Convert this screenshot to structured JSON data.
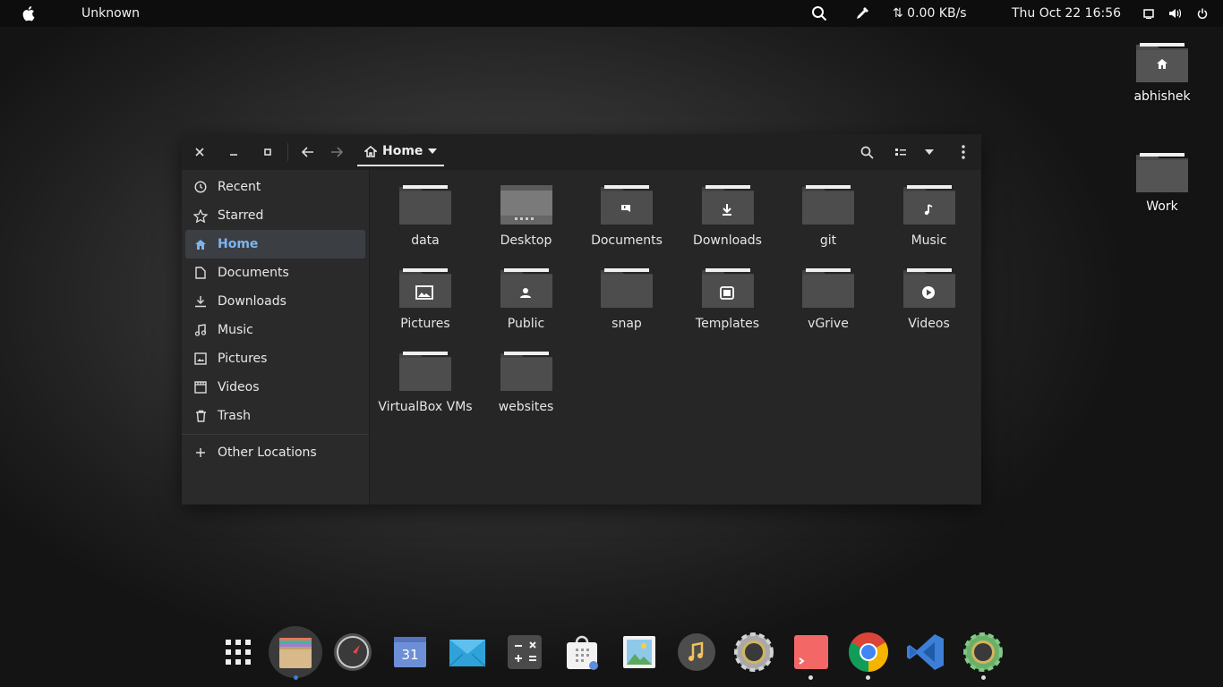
{
  "topbar": {
    "app_name": "Unknown",
    "network": "⇅ 0.00 KB/s",
    "clock": "Thu Oct 22  16:56",
    "icons": [
      "apple-icon",
      "search-icon",
      "color-picker-icon",
      "screen-icon",
      "volume-icon",
      "power-icon"
    ]
  },
  "desktop": {
    "icons": [
      {
        "label": "abhishek",
        "icon": "home-folder-icon"
      },
      {
        "label": "Work",
        "icon": "folder-icon"
      }
    ]
  },
  "window": {
    "location": "Home",
    "sidebar": {
      "items": [
        {
          "label": "Recent",
          "icon": "clock-icon"
        },
        {
          "label": "Starred",
          "icon": "star-icon"
        },
        {
          "label": "Home",
          "icon": "home-icon",
          "active": true
        },
        {
          "label": "Documents",
          "icon": "document-icon"
        },
        {
          "label": "Downloads",
          "icon": "download-icon"
        },
        {
          "label": "Music",
          "icon": "music-icon"
        },
        {
          "label": "Pictures",
          "icon": "picture-icon"
        },
        {
          "label": "Videos",
          "icon": "video-icon"
        },
        {
          "label": "Trash",
          "icon": "trash-icon"
        }
      ],
      "other": {
        "label": "Other Locations",
        "icon": "plus-icon"
      }
    },
    "files": [
      {
        "name": "data",
        "emblem": "none"
      },
      {
        "name": "Desktop",
        "emblem": "desktop"
      },
      {
        "name": "Documents",
        "emblem": "document"
      },
      {
        "name": "Downloads",
        "emblem": "download"
      },
      {
        "name": "git",
        "emblem": "none"
      },
      {
        "name": "Music",
        "emblem": "music"
      },
      {
        "name": "Pictures",
        "emblem": "picture"
      },
      {
        "name": "Public",
        "emblem": "person"
      },
      {
        "name": "snap",
        "emblem": "none"
      },
      {
        "name": "Templates",
        "emblem": "template"
      },
      {
        "name": "vGrive",
        "emblem": "none"
      },
      {
        "name": "Videos",
        "emblem": "play"
      },
      {
        "name": "VirtualBox VMs",
        "emblem": "none"
      },
      {
        "name": "websites",
        "emblem": "none"
      }
    ]
  },
  "dock": {
    "apps": [
      {
        "name": "app-grid-icon",
        "running": false
      },
      {
        "name": "files-icon",
        "running": true
      },
      {
        "name": "compass-icon",
        "running": false
      },
      {
        "name": "calendar-icon",
        "running": false,
        "label": "31"
      },
      {
        "name": "mail-icon",
        "running": false
      },
      {
        "name": "calculator-icon",
        "running": false
      },
      {
        "name": "software-store-icon",
        "running": false
      },
      {
        "name": "image-viewer-icon",
        "running": false
      },
      {
        "name": "music-player-icon",
        "running": false
      },
      {
        "name": "settings-icon",
        "running": false
      },
      {
        "name": "terminal-icon",
        "running": true
      },
      {
        "name": "chrome-icon",
        "running": true
      },
      {
        "name": "vscode-icon",
        "running": false
      },
      {
        "name": "system-settings-icon",
        "running": true
      }
    ]
  }
}
